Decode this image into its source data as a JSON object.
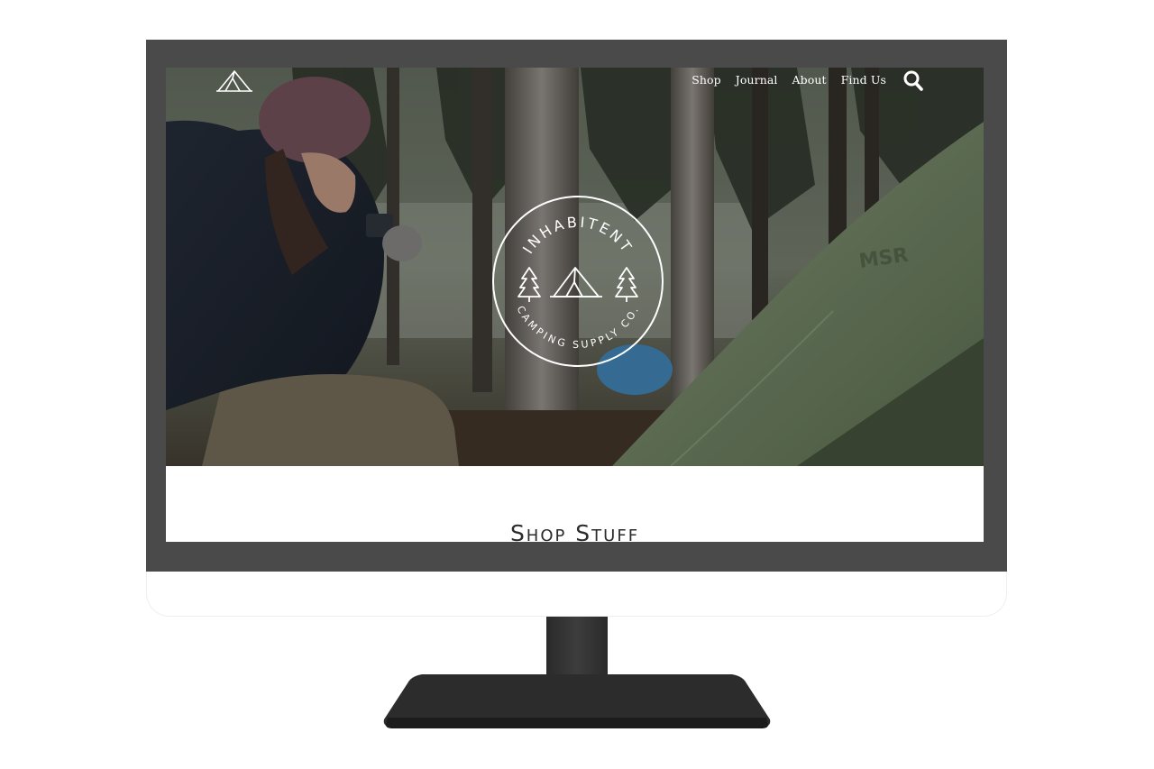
{
  "site": {
    "logo_icon": "tent-icon",
    "nav": [
      {
        "label": "Shop"
      },
      {
        "label": "Journal"
      },
      {
        "label": "About"
      },
      {
        "label": "Find Us"
      }
    ],
    "search_icon": "search-icon"
  },
  "hero": {
    "badge": {
      "top_text": "INHABITENT",
      "bottom_text": "CAMPING SUPPLY CO.",
      "icons": [
        "pine-tree-icon",
        "tent-icon",
        "pine-tree-icon"
      ]
    },
    "tent_brand": "MSR"
  },
  "main": {
    "section_title": "Shop Stuff"
  },
  "colors": {
    "bezel": "#4a4a4a",
    "stand": "#2c2c2c",
    "tent": "#6f8163",
    "text_dark": "#2b2b2b"
  }
}
